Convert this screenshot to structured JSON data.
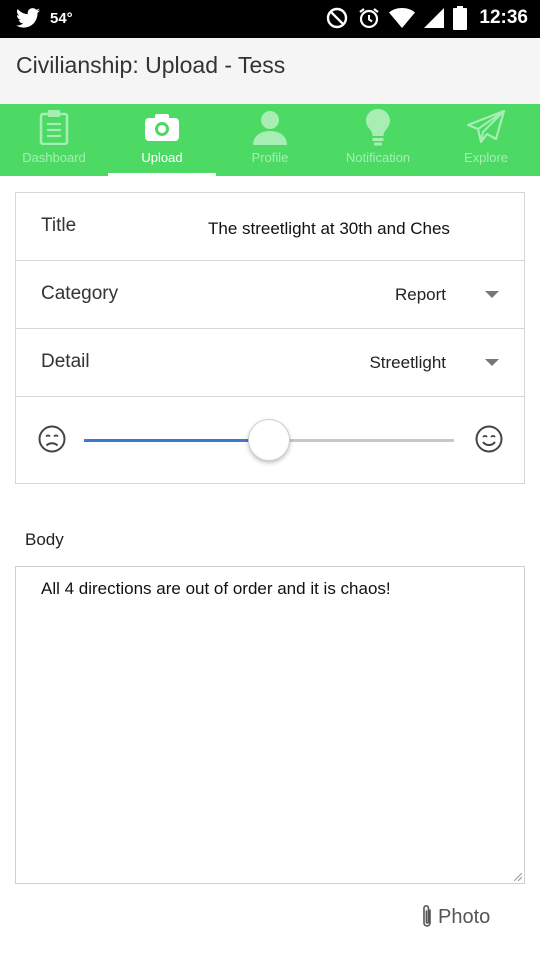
{
  "status_bar": {
    "temperature": "54°",
    "time": "12:36"
  },
  "app_bar": {
    "title": "Civilianship: Upload - Tess"
  },
  "tabs": [
    {
      "label": "Dashboard",
      "icon": "clipboard-icon",
      "active": false
    },
    {
      "label": "Upload",
      "icon": "camera-icon",
      "active": true
    },
    {
      "label": "Profile",
      "icon": "person-icon",
      "active": false
    },
    {
      "label": "Notification",
      "icon": "lightbulb-icon",
      "active": false
    },
    {
      "label": "Explore",
      "icon": "paper-plane-icon",
      "active": false
    }
  ],
  "form": {
    "title_label": "Title",
    "title_value": "The streetlight at 30th and Ches",
    "category_label": "Category",
    "category_value": "Report",
    "detail_label": "Detail",
    "detail_value": "Streetlight",
    "mood_slider": {
      "value": 0.5,
      "min_icon": "sad-face-icon",
      "max_icon": "happy-face-icon"
    }
  },
  "body": {
    "label": "Body",
    "value": "All 4 directions are out of order and it is chaos!"
  },
  "photo_button": {
    "label": "Photo",
    "icon": "paperclip-icon"
  },
  "colors": {
    "tab_bar": "#4cd964",
    "slider_fill": "#3b78d8",
    "status_bar": "#000000"
  }
}
